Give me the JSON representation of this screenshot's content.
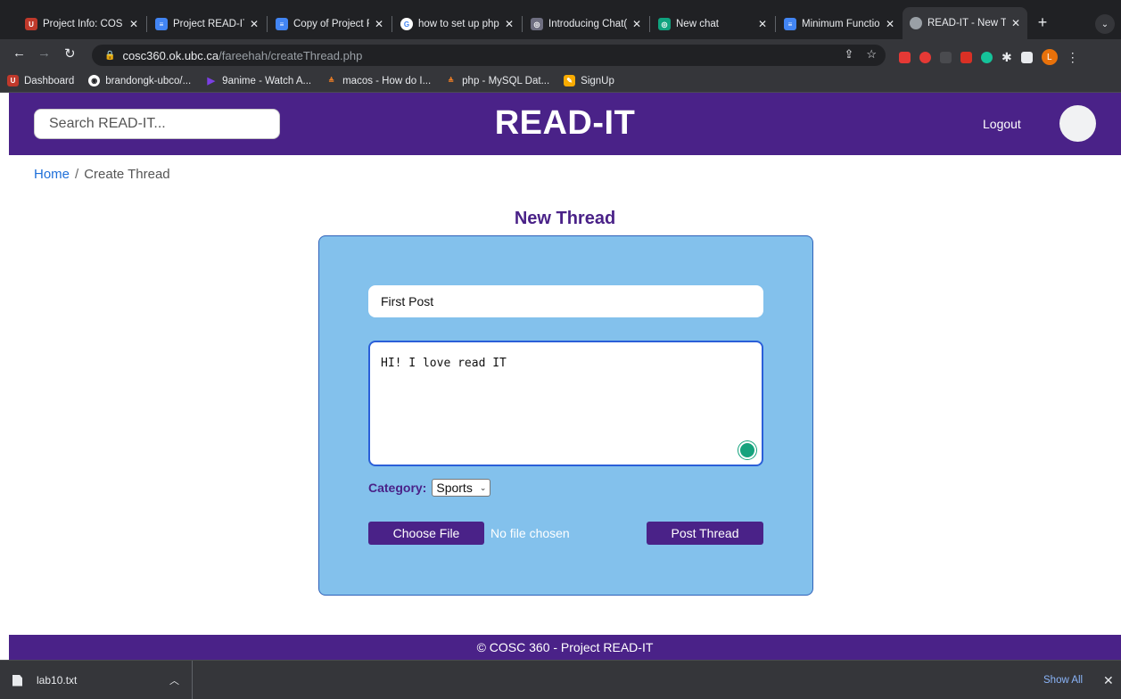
{
  "browser": {
    "tabs": [
      {
        "title": "Project Info: COS",
        "favicon": "ubc-icon",
        "color": "#c0392b"
      },
      {
        "title": "Project READ-IT",
        "favicon": "docs-icon",
        "color": "#4285f4"
      },
      {
        "title": "Copy of Project R",
        "favicon": "docs-icon",
        "color": "#4285f4"
      },
      {
        "title": "how to set up php",
        "favicon": "google-icon",
        "color": "#ffffff"
      },
      {
        "title": "Introducing Chat(",
        "favicon": "openai-icon",
        "color": "#6e6e80"
      },
      {
        "title": "New chat",
        "favicon": "chatgpt-icon",
        "color": "#10a37f"
      },
      {
        "title": "Minimum Functio",
        "favicon": "docs-icon",
        "color": "#4285f4"
      },
      {
        "title": "READ-IT - New T",
        "favicon": "globe-icon",
        "color": "#9aa0a6"
      }
    ],
    "url_host": "cosc360.ok.ubc.ca",
    "url_path": "/fareehah/createThread.php",
    "bookmarks": [
      {
        "label": "Dashboard",
        "icon": "ubc-icon",
        "color": "#c0392b"
      },
      {
        "label": "brandongk-ubco/...",
        "icon": "github-icon",
        "color": "#ffffff"
      },
      {
        "label": "9anime - Watch A...",
        "icon": "play-icon",
        "color": "#7b3fe4"
      },
      {
        "label": "macos - How do I...",
        "icon": "stackoverflow-icon",
        "color": "#f48024"
      },
      {
        "label": "php - MySQL Dat...",
        "icon": "stackoverflow-icon",
        "color": "#f48024"
      },
      {
        "label": "SignUp",
        "icon": "signup-icon",
        "color": "#f9ab00"
      }
    ],
    "profile_initial": "L"
  },
  "header": {
    "search_placeholder": "Search READ-IT...",
    "brand": "READ-IT",
    "logout": "Logout"
  },
  "breadcrumb": {
    "home": "Home",
    "separator": "/",
    "current": "Create Thread"
  },
  "form": {
    "heading": "New Thread",
    "title_value": "First Post",
    "body_value": "HI! I love read IT",
    "category_label": "Category:",
    "category_value": "Sports",
    "choose_file": "Choose File",
    "file_status": "No file chosen",
    "submit": "Post Thread"
  },
  "footer": {
    "text": "© COSC 360 - Project READ-IT"
  },
  "downloads": {
    "file": "lab10.txt",
    "show_all": "Show All"
  }
}
